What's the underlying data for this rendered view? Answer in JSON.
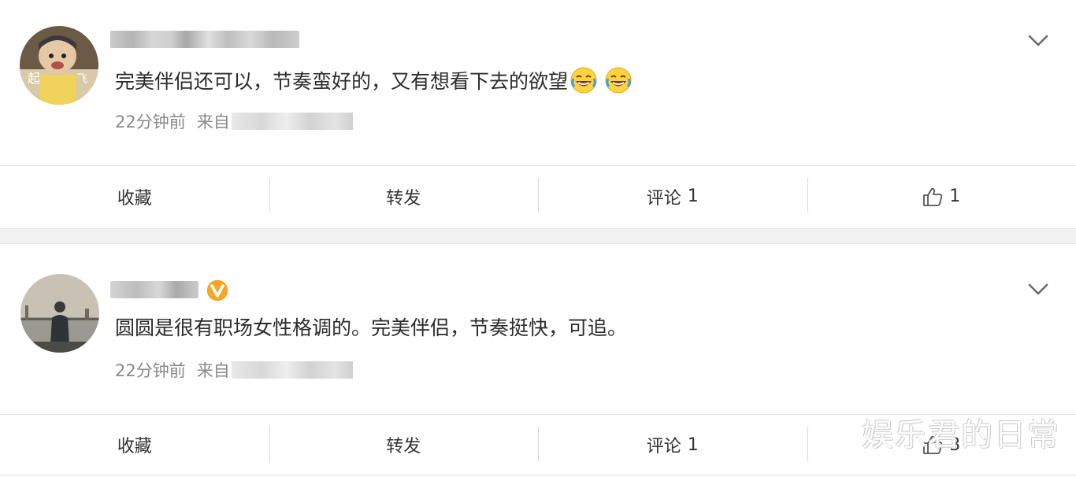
{
  "posts": [
    {
      "content": "完美伴侣还可以，节奏蛮好的，又有想看下去的欲望",
      "emojis": [
        "laugh-cry-emoji",
        "laugh-cry-emoji"
      ],
      "time": "22分钟前",
      "from_label": "来自",
      "actions": {
        "favorite": "收藏",
        "repost": "转发",
        "comment": "评论",
        "comment_count": "1",
        "like_count": "1"
      }
    },
    {
      "content": "圆圆是很有职场女性格调的。完美伴侣，节奏挺快，可追。",
      "time": "22分钟前",
      "from_label": "来自",
      "actions": {
        "favorite": "收藏",
        "repost": "转发",
        "comment": "评论",
        "comment_count": "1",
        "like_count": "3"
      }
    }
  ],
  "icons": {
    "verified_badge": "vip-v-icon",
    "more": "chevron-down-icon",
    "like": "thumbs-up-icon"
  },
  "colors": {
    "badge": "#f5a623",
    "text": "#2b2b2b",
    "meta": "#8a8a8a",
    "divider": "#e3e3e3"
  },
  "watermark": "娱乐君的日常"
}
